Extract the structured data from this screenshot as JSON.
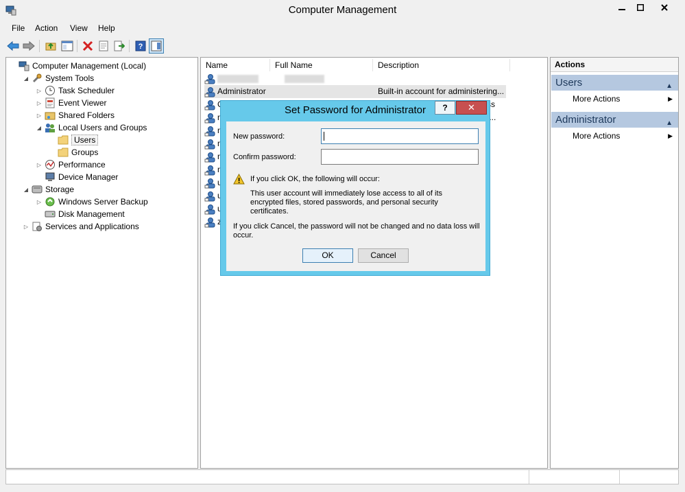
{
  "window": {
    "title": "Computer Management"
  },
  "menu": [
    "File",
    "Action",
    "View",
    "Help"
  ],
  "tree": [
    {
      "label": "Computer Management (Local)",
      "indent": 0,
      "exp": "",
      "icon": "computer-management-icon"
    },
    {
      "label": "System Tools",
      "indent": 1,
      "exp": "◢",
      "icon": "tools-icon"
    },
    {
      "label": "Task Scheduler",
      "indent": 2,
      "exp": "▷",
      "icon": "clock-icon"
    },
    {
      "label": "Event Viewer",
      "indent": 2,
      "exp": "▷",
      "icon": "event-viewer-icon"
    },
    {
      "label": "Shared Folders",
      "indent": 2,
      "exp": "▷",
      "icon": "shared-folder-icon"
    },
    {
      "label": "Local Users and Groups",
      "indent": 2,
      "exp": "◢",
      "icon": "users-group-icon"
    },
    {
      "label": "Users",
      "indent": 3,
      "exp": "",
      "icon": "folder-icon",
      "selected": true
    },
    {
      "label": "Groups",
      "indent": 3,
      "exp": "",
      "icon": "folder-icon"
    },
    {
      "label": "Performance",
      "indent": 2,
      "exp": "▷",
      "icon": "performance-icon"
    },
    {
      "label": "Device Manager",
      "indent": 2,
      "exp": "",
      "icon": "device-manager-icon"
    },
    {
      "label": "Storage",
      "indent": 1,
      "exp": "◢",
      "icon": "storage-icon"
    },
    {
      "label": "Windows Server Backup",
      "indent": 2,
      "exp": "▷",
      "icon": "backup-icon"
    },
    {
      "label": "Disk Management",
      "indent": 2,
      "exp": "",
      "icon": "disk-icon"
    },
    {
      "label": "Services and Applications",
      "indent": 1,
      "exp": "▷",
      "icon": "services-icon"
    }
  ],
  "list": {
    "columns": [
      "Name",
      "Full Name",
      "Description"
    ],
    "rows": [
      {
        "name": "",
        "full": "",
        "desc": "",
        "blurred": true
      },
      {
        "name": "Administrator",
        "full": "",
        "desc": "Built-in account for administering..."
      },
      {
        "name": "G",
        "full": "",
        "desc": "ss t..."
      },
      {
        "name": "n",
        "full": "",
        "desc": ""
      },
      {
        "name": "n",
        "full": "",
        "desc": ""
      },
      {
        "name": "n",
        "full": "",
        "desc": ""
      },
      {
        "name": "n",
        "full": "",
        "desc": ""
      },
      {
        "name": "n",
        "full": "",
        "desc": ""
      },
      {
        "name": "u",
        "full": "",
        "desc": ""
      },
      {
        "name": "u",
        "full": "",
        "desc": ""
      },
      {
        "name": "u",
        "full": "",
        "desc": ""
      },
      {
        "name": "z",
        "full": "",
        "desc": ""
      }
    ]
  },
  "actions": {
    "header": "Actions",
    "groups": [
      {
        "title": "Users",
        "items": [
          "More Actions"
        ]
      },
      {
        "title": "Administrator",
        "items": [
          "More Actions"
        ]
      }
    ]
  },
  "dialog": {
    "title": "Set Password for Administrator",
    "help": "?",
    "close": "✕",
    "new_password_label": "New password:",
    "confirm_password_label": "Confirm password:",
    "warning_heading": "If you click OK, the following will occur:",
    "warning_body": "This user account will immediately lose access to all of its encrypted files, stored passwords, and personal security certificates.",
    "cancel_note": "If you click Cancel, the password will not be changed and no data loss will occur.",
    "ok_label": "OK",
    "cancel_label": "Cancel"
  }
}
